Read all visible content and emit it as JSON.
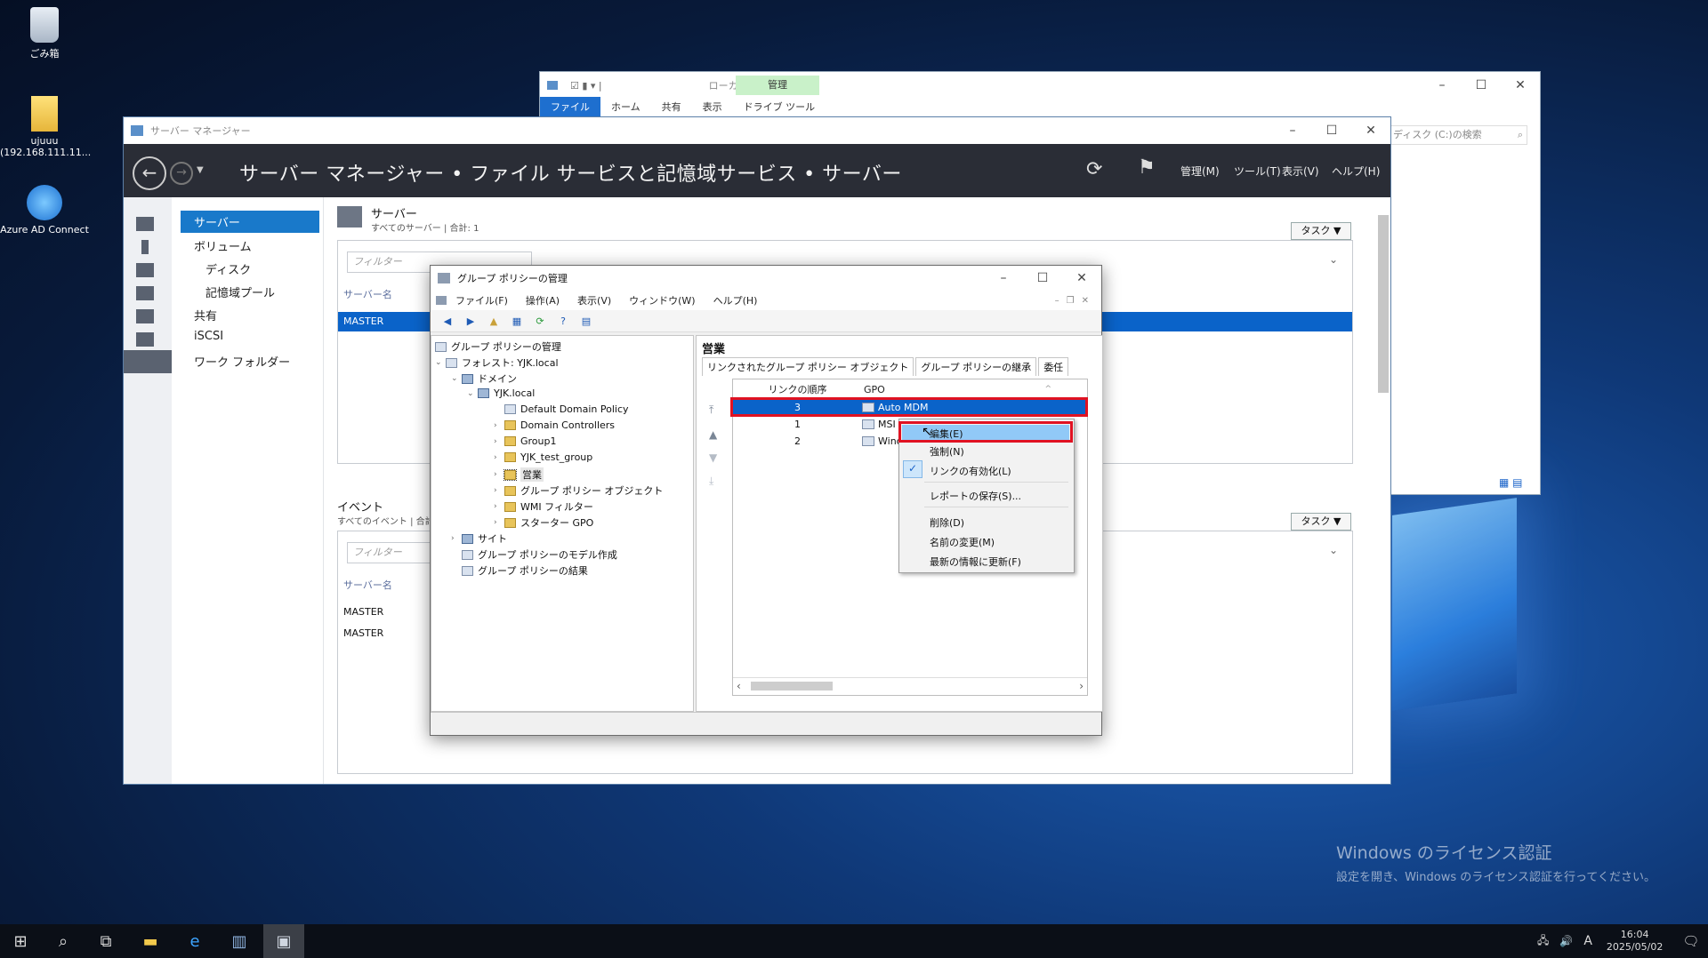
{
  "desktop": {
    "icons": [
      {
        "label": "ごみ箱"
      },
      {
        "label": "ujuuu\n(192.168.111.11..."
      },
      {
        "label": "Azure AD Connect"
      }
    ],
    "watermark": {
      "title": "Windows のライセンス認証",
      "subtitle": "設定を開き、Windows のライセンス認証を行ってください。"
    }
  },
  "taskbar": {
    "clock_time": "16:04",
    "clock_date": "2025/05/02",
    "ime": "A"
  },
  "explorer": {
    "title": "ローカル ディスク (C:)",
    "context_tab": "管理",
    "context_subtab": "ドライブ ツール",
    "tabs": [
      "ファイル",
      "ホーム",
      "共有",
      "表示"
    ],
    "search_placeholder": "ディスク (C:)の検索"
  },
  "server_manager": {
    "title": "サーバー マネージャー",
    "breadcrumb": "サーバー マネージャー • ファイル サービスと記憶域サービス • サーバー",
    "menus": [
      "管理(M)",
      "ツール(T)",
      "表示(V)",
      "ヘルプ(H)"
    ],
    "nav": [
      "サーバー",
      "ボリューム",
      "ディスク",
      "記憶域プール",
      "共有",
      "iSCSI",
      "ワーク フォルダー"
    ],
    "servers_panel": {
      "title": "サーバー",
      "subtitle": "すべてのサーバー | 合計: 1",
      "task_label": "タスク",
      "filter_placeholder": "フィルター",
      "column": "サーバー名",
      "row": "MASTER"
    },
    "events_panel": {
      "title": "イベント",
      "subtitle": "すべてのイベント | 合計",
      "task_label": "タスク",
      "filter_placeholder": "フィルター",
      "column": "サーバー名",
      "rows": [
        "MASTER",
        "MASTER"
      ]
    }
  },
  "gpmc": {
    "title": "グループ ポリシーの管理",
    "menus": [
      "ファイル(F)",
      "操作(A)",
      "表示(V)",
      "ウィンドウ(W)",
      "ヘルプ(H)"
    ],
    "tree": {
      "root": "グループ ポリシーの管理",
      "forest": "フォレスト: YJK.local",
      "domains": "ドメイン",
      "domain": "YJK.local",
      "children": [
        "Default Domain Policy",
        "Domain Controllers",
        "Group1",
        "YJK_test_group",
        "営業",
        "グループ ポリシー オブジェクト",
        "WMI フィルター",
        "スターター GPO"
      ],
      "sites": "サイト",
      "modeling": "グループ ポリシーのモデル作成",
      "results": "グループ ポリシーの結果"
    },
    "right_panel": {
      "title": "営業",
      "tabs": [
        "リンクされたグループ ポリシー オブジェクト",
        "グループ ポリシーの継承",
        "委任"
      ],
      "columns": {
        "order": "リンクの順序",
        "gpo": "GPO"
      },
      "rows": [
        {
          "order": "3",
          "gpo": "Auto MDM"
        },
        {
          "order": "1",
          "gpo": "MSI"
        },
        {
          "order": "2",
          "gpo": "Winc"
        }
      ]
    }
  },
  "context_menu": {
    "items": [
      "編集(E)",
      "強制(N)",
      "リンクの有効化(L)",
      "レポートの保存(S)...",
      "削除(D)",
      "名前の変更(M)",
      "最新の情報に更新(F)"
    ],
    "checked_item": "リンクの有効化(L)"
  },
  "colors": {
    "accent": "#1979ca",
    "selection": "#0a63c9",
    "highlight_box": "#e01222",
    "header_dark": "#2a2d36"
  }
}
